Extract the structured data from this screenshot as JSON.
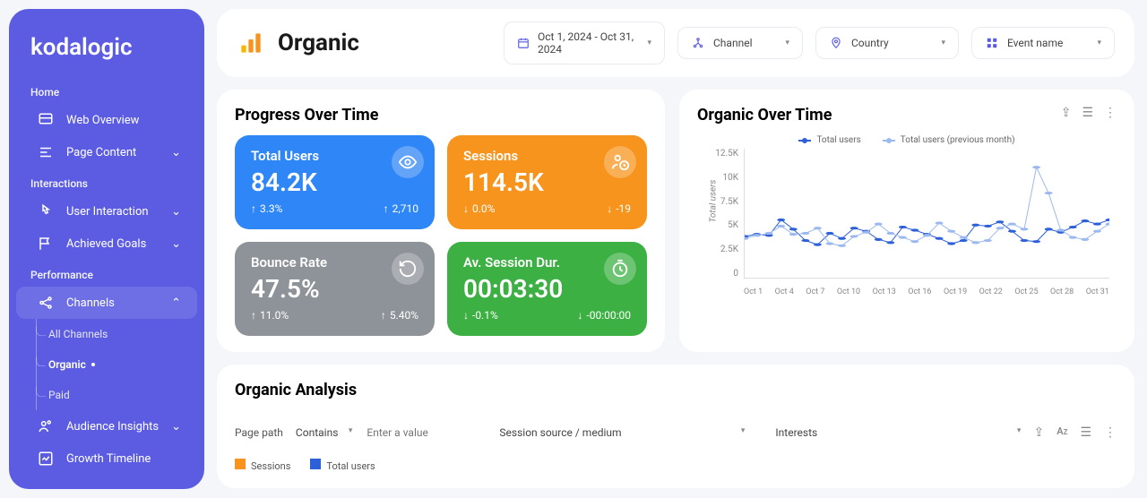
{
  "brand": "kodalogic",
  "sidebar": {
    "sections": [
      {
        "title": "Home",
        "items": [
          {
            "label": "Web Overview"
          },
          {
            "label": "Page Content",
            "chevron": true
          }
        ]
      },
      {
        "title": "Interactions",
        "items": [
          {
            "label": "User Interaction",
            "chevron": true
          },
          {
            "label": "Achieved Goals",
            "chevron": true
          }
        ]
      },
      {
        "title": "Performance",
        "items": [
          {
            "label": "Channels",
            "chevron": true,
            "expanded": true,
            "children": [
              {
                "label": "All Channels"
              },
              {
                "label": "Organic",
                "active": true
              },
              {
                "label": "Paid"
              }
            ]
          },
          {
            "label": "Audience Insights",
            "chevron": true
          },
          {
            "label": "Growth Timeline"
          }
        ]
      }
    ]
  },
  "page": {
    "title": "Organic"
  },
  "filters": {
    "date": "Oct 1, 2024 - Oct 31, 2024",
    "channel": "Channel",
    "country": "Country",
    "event": "Event name"
  },
  "progress": {
    "title": "Progress Over Time",
    "kpis": [
      {
        "label": "Total Users",
        "value": "84.2K",
        "pct": "3.3%",
        "delta": "2,710",
        "dir": "up",
        "color": "blue",
        "icon": "eye"
      },
      {
        "label": "Sessions",
        "value": "114.5K",
        "pct": "0.0%",
        "delta": "-19",
        "dir": "down",
        "color": "orange",
        "icon": "person-clock"
      },
      {
        "label": "Bounce Rate",
        "value": "47.5%",
        "pct": "11.0%",
        "delta": "5.40%",
        "dir": "up",
        "color": "gray",
        "icon": "reload"
      },
      {
        "label": "Av. Session Dur.",
        "value": "00:03:30",
        "pct": "-0.1%",
        "delta": "-00:00:00",
        "dir": "down",
        "color": "green",
        "icon": "stopwatch"
      }
    ]
  },
  "chart": {
    "title": "Organic Over Time",
    "legend": [
      "Total users",
      "Total users (previous month)"
    ],
    "ylabel": "Total users",
    "yticks": [
      "12.5K",
      "10K",
      "7.5K",
      "5K",
      "2.5K",
      "0"
    ],
    "xticks": [
      "Oct 1",
      "Oct 4",
      "Oct 7",
      "Oct 10",
      "Oct 13",
      "Oct 16",
      "Oct 19",
      "Oct 22",
      "Oct 25",
      "Oct 28",
      "Oct 31"
    ]
  },
  "analysis": {
    "title": "Organic Analysis",
    "page_path_label": "Page path",
    "contains": "Contains",
    "placeholder": "Enter a value",
    "source": "Session source / medium",
    "interests": "Interests",
    "legend": [
      "Sessions",
      "Total users"
    ]
  },
  "chart_data": {
    "type": "line",
    "title": "Organic Over Time",
    "xlabel": "",
    "ylabel": "Total users",
    "ylim": [
      0,
      12500
    ],
    "x": [
      "Oct 1",
      "Oct 2",
      "Oct 3",
      "Oct 4",
      "Oct 5",
      "Oct 6",
      "Oct 7",
      "Oct 8",
      "Oct 9",
      "Oct 10",
      "Oct 11",
      "Oct 12",
      "Oct 13",
      "Oct 14",
      "Oct 15",
      "Oct 16",
      "Oct 17",
      "Oct 18",
      "Oct 19",
      "Oct 20",
      "Oct 21",
      "Oct 22",
      "Oct 23",
      "Oct 24",
      "Oct 25",
      "Oct 26",
      "Oct 27",
      "Oct 28",
      "Oct 29",
      "Oct 30",
      "Oct 31"
    ],
    "series": [
      {
        "name": "Total users",
        "color": "#2d5fd9",
        "values": [
          4000,
          4200,
          4100,
          5600,
          4700,
          3600,
          3200,
          4300,
          3800,
          4800,
          4500,
          3700,
          3400,
          4900,
          4600,
          4200,
          3800,
          3300,
          3600,
          5100,
          5000,
          5400,
          4500,
          3600,
          3500,
          4700,
          4400,
          4900,
          5500,
          5200,
          5600
        ]
      },
      {
        "name": "Total users (previous month)",
        "color": "#9cb9ef",
        "values": [
          3800,
          4100,
          4300,
          5000,
          4200,
          4300,
          4800,
          3300,
          3100,
          4000,
          4400,
          5200,
          4300,
          3900,
          3500,
          4100,
          5300,
          4500,
          3900,
          3400,
          3600,
          4800,
          5200,
          4700,
          10700,
          8200,
          4600,
          3900,
          3700,
          4500,
          5200
        ]
      }
    ]
  }
}
